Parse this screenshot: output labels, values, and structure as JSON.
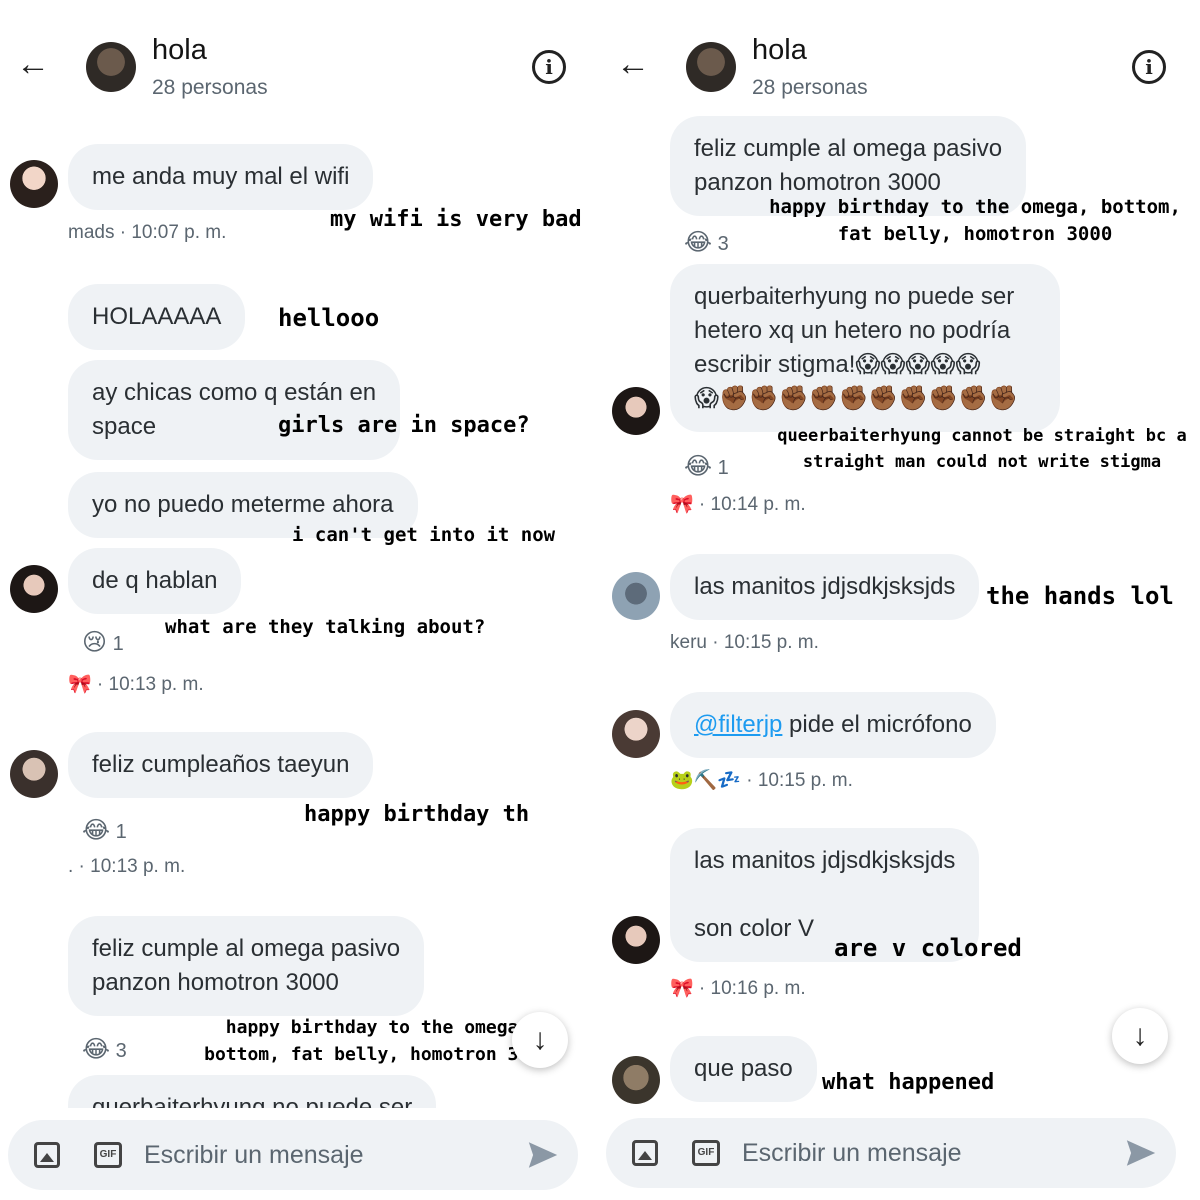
{
  "left": {
    "header": {
      "title": "hola",
      "subtitle": "28 personas"
    },
    "messages": {
      "m1": "me anda muy mal el wifi",
      "m2": "HOLAAAAA",
      "m3": "ay chicas como q están en\nspace",
      "m4": "yo no puedo meterme ahora",
      "m5": "de q hablan",
      "m6": "feliz cumpleaños taeyun",
      "m7": "feliz cumple al omega pasivo\npanzon homotron 3000",
      "m8": "querbaiterhyung no puede ser"
    },
    "meta": {
      "mads": "mads · 10:07 p. m.",
      "t1": "🎀 · 10:13 p. m.",
      "t2": ". · 10:13 p. m."
    },
    "reactions": {
      "r1_emoji": "😢",
      "r1_count": "1",
      "r2_emoji": "😂",
      "r2_count": "1",
      "r3_emoji": "😂",
      "r3_count": "3"
    },
    "captions": {
      "c1": "my wifi is very bad",
      "c2": "hellooo",
      "c3": "girls are in space?",
      "c4": "i can't get into it now",
      "c5": "what are they talking about?",
      "c6": "happy birthday th",
      "c7": "happy birthday to the omega,\nbottom, fat belly, homotron 3000"
    },
    "composer": {
      "placeholder": "Escribir un mensaje"
    }
  },
  "right": {
    "header": {
      "title": "hola",
      "subtitle": "28 personas"
    },
    "messages": {
      "m1": "feliz cumple al omega pasivo\npanzon homotron 3000",
      "m2": "querbaiterhyung no puede ser\nhetero xq un hetero no podría\nescribir stigma!😱😱😱😱😱\n😱✊🏾✊🏾✊🏾✊🏾✊🏾✊🏾✊🏾✊🏾✊🏾✊🏾",
      "m3": "las manitos jdjsdkjsksjds",
      "m4_mention": "@filterjp",
      "m4_rest": " pide el micrófono",
      "m5": "las manitos jdjsdkjsksjds\n\nson color V",
      "m6": "que paso"
    },
    "meta": {
      "t1": "🎀 · 10:14 p. m.",
      "keru": "keru · 10:15 p. m.",
      "t2": "🐸⛏️💤 · 10:15 p. m.",
      "t3": "🎀 · 10:16 p. m."
    },
    "reactions": {
      "r1_emoji": "😂",
      "r1_count": "3",
      "r2_emoji": "😂",
      "r2_count": "1"
    },
    "captions": {
      "c1": "happy birthday to the omega, bottom,\nfat belly, homotron 3000",
      "c2": "queerbaiterhyung cannot be straight bc a\nstraight man could not write stigma",
      "c3": "the hands lol",
      "c4": "are v colored",
      "c5": "what happened"
    },
    "composer": {
      "placeholder": "Escribir un mensaje"
    }
  },
  "icons": {
    "back": "arrow-left-icon",
    "info": "info-icon",
    "image": "image-icon",
    "gif": "gif-icon",
    "send": "send-icon",
    "scroll_down": "arrow-down-icon"
  },
  "colors": {
    "bubble": "#eff2f5",
    "meta": "#5b6670",
    "link": "#1d9bf0"
  }
}
